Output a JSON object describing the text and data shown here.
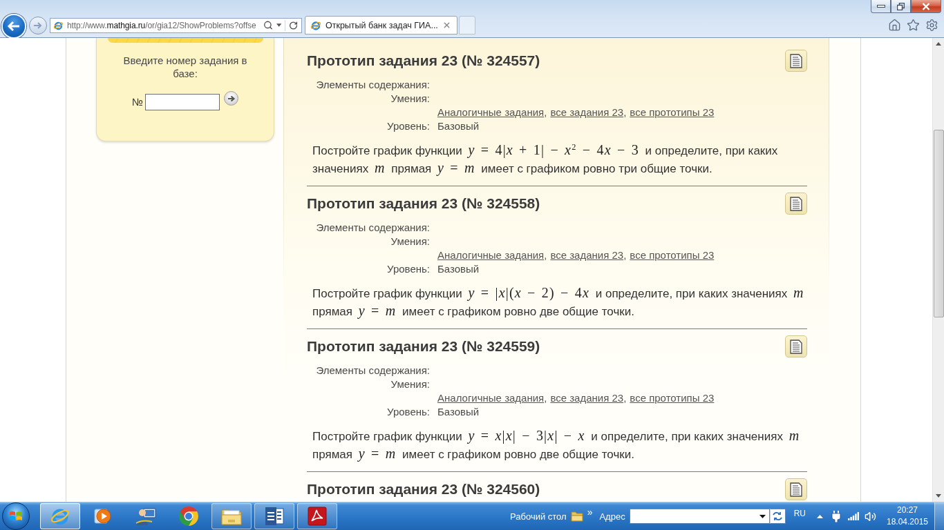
{
  "browser": {
    "url": {
      "before": "http://www.",
      "domain": "mathgia.ru",
      "after": "/or/gia12/ShowProblems?offse"
    },
    "tabs": [
      {
        "title": "Открытый банк задач ГИА...",
        "selected": true
      }
    ]
  },
  "sidebar": {
    "prompt": "Введите номер задания в базе:",
    "number_label": "№"
  },
  "problems": [
    {
      "title": "Прототип задания 23 (№ 324557)",
      "meta": [
        {
          "kind": "field",
          "label": "Элементы содержания:"
        },
        {
          "kind": "field",
          "label": "Умения:"
        },
        {
          "kind": "links",
          "links": [
            {
              "text": "Аналогичные задания",
              "separator": ","
            },
            {
              "text": "все задания 23",
              "separator": ","
            },
            {
              "text": "все прототипы 23"
            }
          ]
        },
        {
          "kind": "field",
          "label": "Уровень:",
          "value": "Базовый"
        }
      ],
      "statement": [
        {
          "kind": "text",
          "text": "Постройте график функции "
        },
        {
          "kind": "math",
          "text": "*y* = 4|*x* + 1| − *x*$^{2}$ − 4"
        },
        {
          "kind": "math",
          "text": "*x* − 3"
        },
        {
          "kind": "text",
          "text": " и определите, при каких значениях "
        },
        {
          "kind": "math",
          "text": "*m*"
        },
        {
          "kind": "text",
          "text": " прямая "
        },
        {
          "kind": "math",
          "text": "*y* = *m*"
        },
        {
          "kind": "text",
          "text": " имеет с графиком ровно три общие точки."
        }
      ]
    },
    {
      "title": "Прототип задания 23 (№ 324558)",
      "meta": [
        {
          "kind": "field",
          "label": "Элементы содержания:"
        },
        {
          "kind": "field",
          "label": "Умения:"
        },
        {
          "kind": "links",
          "links": [
            {
              "text": "Аналогичные задания",
              "separator": ","
            },
            {
              "text": "все задания 23",
              "separator": ","
            },
            {
              "text": "все прототипы 23"
            }
          ]
        },
        {
          "kind": "field",
          "label": "Уровень:",
          "value": "Базовый"
        }
      ],
      "statement": [
        {
          "kind": "text",
          "text": "Постройте график функции "
        },
        {
          "kind": "math",
          "text": "*y* = |*x*|(*x* − 2) − 4"
        },
        {
          "kind": "math",
          "text": "*x*"
        },
        {
          "kind": "text",
          "text": " и определите, при каких значениях "
        },
        {
          "kind": "math",
          "text": "*m*"
        },
        {
          "kind": "text",
          "text": " прямая "
        },
        {
          "kind": "math",
          "text": "*y* = *m*"
        },
        {
          "kind": "text",
          "text": " имеет с графиком ровно две общие точки."
        }
      ]
    },
    {
      "title": "Прототип задания 23 (№ 324559)",
      "meta": [
        {
          "kind": "field",
          "label": "Элементы содержания:"
        },
        {
          "kind": "field",
          "label": "Умения:"
        },
        {
          "kind": "links",
          "links": [
            {
              "text": "Аналогичные задания",
              "separator": ","
            },
            {
              "text": "все задания 23",
              "separator": ","
            },
            {
              "text": "все прототипы 23"
            }
          ]
        },
        {
          "kind": "field",
          "label": "Уровень:",
          "value": "Базовый"
        }
      ],
      "statement": [
        {
          "kind": "text",
          "text": "Постройте график функции "
        },
        {
          "kind": "math",
          "text": "*y* = *x*|*x*| − 3|*x*| − *x*"
        },
        {
          "kind": "text",
          "text": " и определите, при каких значениях "
        },
        {
          "kind": "math",
          "text": "*m*"
        },
        {
          "kind": "text",
          "text": " прямая "
        },
        {
          "kind": "math",
          "text": "*y* = *m*"
        },
        {
          "kind": "text",
          "text": " имеет с графиком ровно две общие точки."
        }
      ]
    },
    {
      "title": "Прототип задания 23 (№ 324560)"
    }
  ],
  "taskbar": {
    "apps": [
      {
        "kind": "browser",
        "open": true,
        "selected": true
      },
      {
        "kind": "media",
        "open": false,
        "selected": false
      },
      {
        "kind": "remote",
        "open": false,
        "selected": false
      },
      {
        "kind": "chrome",
        "open": false,
        "selected": false
      },
      {
        "kind": "explorer",
        "open": true,
        "selected": false
      },
      {
        "kind": "word",
        "open": true,
        "selected": false
      },
      {
        "kind": "pdf",
        "open": true,
        "selected": false
      }
    ],
    "toolbar": {
      "label": "Рабочий стол",
      "overflow": "»",
      "address_label": "Адрес"
    },
    "language": "RU",
    "time": "20:27",
    "date": "18.04.2015"
  }
}
